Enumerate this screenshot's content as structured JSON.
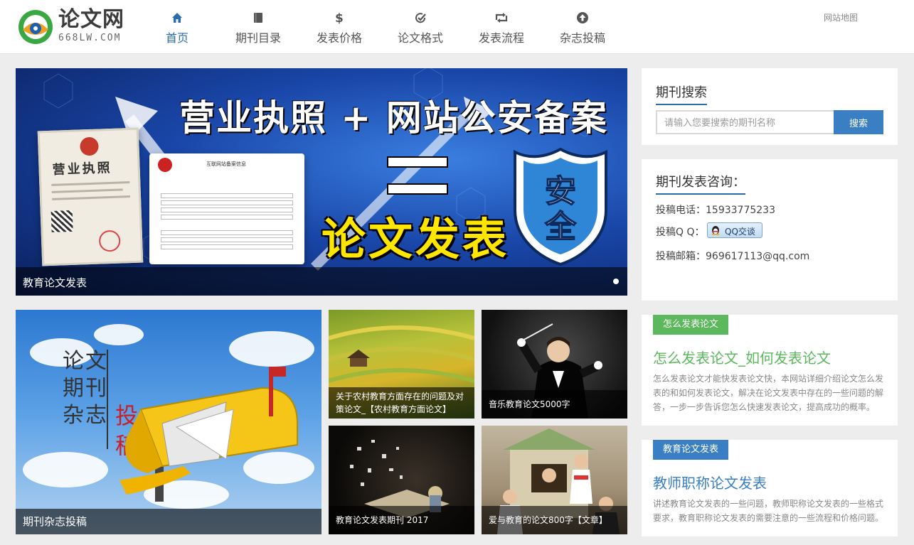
{
  "brand": {
    "name": "论文网",
    "domain": "668LW.COM"
  },
  "nav": [
    {
      "label": "首页",
      "icon": "home-icon",
      "active": true
    },
    {
      "label": "期刊目录",
      "icon": "book-icon",
      "active": false
    },
    {
      "label": "发表价格",
      "icon": "dollar-icon",
      "active": false
    },
    {
      "label": "论文格式",
      "icon": "check-circle-icon",
      "active": false
    },
    {
      "label": "发表流程",
      "icon": "retweet-icon",
      "active": false
    },
    {
      "label": "杂志投稿",
      "icon": "upload-circle-icon",
      "active": false
    }
  ],
  "sitemap": "网站地图",
  "banner": {
    "title": "营业执照 + 网站公安备案",
    "subtitle": "论文发表",
    "shield_text": [
      "安",
      "全"
    ],
    "license_title": "营业执照",
    "record_title": "互联网站备案信息",
    "caption": "教育论文发表"
  },
  "tiles": {
    "big": {
      "caption": "期刊杂志投稿",
      "poster_lines": [
        "论文",
        "期刊",
        "杂志"
      ],
      "poster_red": [
        "投",
        "稿"
      ]
    },
    "items": [
      {
        "caption": "关于农村教育方面存在的问题及对策论文_【农村教育方面论文】"
      },
      {
        "caption": "音乐教育论文5000字"
      },
      {
        "caption": "教育论文发表期刊 2017"
      },
      {
        "caption": "爱与教育的论文800字【文章】"
      }
    ]
  },
  "search": {
    "heading": "期刊搜索",
    "placeholder": "请输入您要搜索的期刊名称",
    "button": "搜索"
  },
  "contact": {
    "heading": "期刊发表咨询：",
    "phone": "投稿电话：15933775233",
    "qq_label": "投稿Q  Q：",
    "qq_button": "QQ交谈",
    "email": "投稿邮箱：969617113@qq.com"
  },
  "articles": [
    {
      "tag": "怎么发表论文",
      "title": "怎么发表论文_如何发表论文",
      "desc": "怎么发表论文才能快发表论文快，本网站详细介绍论文怎么发表的和如何发表论文，解决在论文发表中存在的一些问题的解答，一步一步告诉您怎么快速发表论文，提高成功的概率。",
      "color": "#5cb85c"
    },
    {
      "tag": "教育论文发表",
      "title": "教师职称论文发表",
      "desc": "讲述教育论文发表的一些问题，教师职称论文发表的一些格式要求，教育职称论文发表的需要注意的一些流程和价格问题。",
      "color": "#3a7fc4"
    }
  ]
}
